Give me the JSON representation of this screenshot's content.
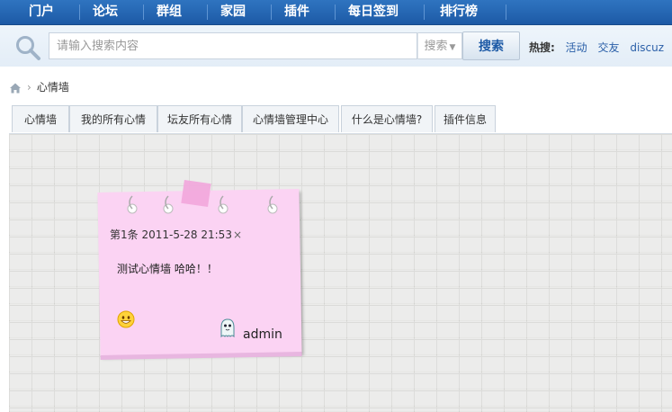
{
  "nav": {
    "items": [
      "门户",
      "论坛",
      "群组",
      "家园",
      "插件",
      "每日签到",
      "排行榜"
    ]
  },
  "search": {
    "placeholder": "请输入搜索内容",
    "select_value": "搜索",
    "button_label": "搜索",
    "hot_label": "热搜:",
    "hot_terms": [
      "活动",
      "交友",
      "discuz"
    ]
  },
  "breadcrumb": {
    "current": "心情墙"
  },
  "tabs": [
    "心情墙",
    "我的所有心情",
    "坛友所有心情",
    "心情墙管理中心",
    "什么是心情墙?",
    "插件信息"
  ],
  "note": {
    "header": "第1条 2011-5-28 21:53",
    "close": "×",
    "message": "测试心情墙 哈哈！！",
    "author": "admin",
    "mood_icon": "smiley-icon",
    "avatar_icon": "ghost-avatar-icon"
  },
  "colors": {
    "nav_bg": "#1d5aa6",
    "note_bg": "#fbd3f3",
    "link": "#2a5fa8"
  }
}
